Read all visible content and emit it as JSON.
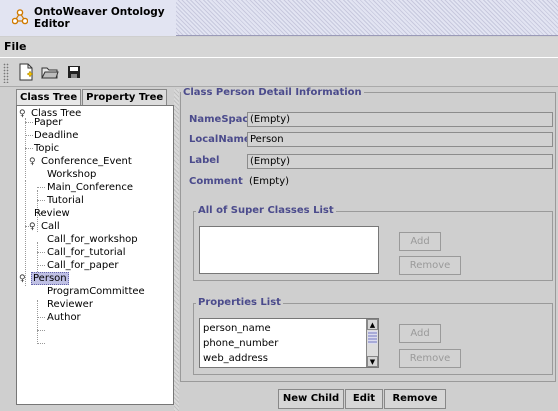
{
  "window": {
    "title": "OntoWeaver Ontology Editor"
  },
  "menu": {
    "items": [
      "File"
    ]
  },
  "toolbar": {
    "icons": [
      "new-file-icon",
      "open-folder-icon",
      "save-disk-icon"
    ]
  },
  "left_tabs": [
    "Class Tree",
    "Property Tree"
  ],
  "tree": {
    "nodes": [
      {
        "label": "Class Tree",
        "expanded": true
      },
      {
        "label": "Paper"
      },
      {
        "label": "Deadline"
      },
      {
        "label": "Topic"
      },
      {
        "label": "Conference_Event",
        "expanded": true
      },
      {
        "label": "Workshop"
      },
      {
        "label": "Main_Conference"
      },
      {
        "label": "Tutorial"
      },
      {
        "label": "Review"
      },
      {
        "label": "Call",
        "expanded": true
      },
      {
        "label": "Call_for_workshop"
      },
      {
        "label": "Call_for_tutorial"
      },
      {
        "label": "Call_for_paper"
      },
      {
        "label": "Person",
        "expanded": true,
        "selected": true
      },
      {
        "label": "ProgramCommittee"
      },
      {
        "label": "Reviewer"
      },
      {
        "label": "Author"
      }
    ]
  },
  "detail": {
    "group_title": "Class Person Detail Information",
    "namespace_label": "NameSpace",
    "namespace_value": "(Empty)",
    "localname_label": "LocalName",
    "localname_value": "Person",
    "label_label": "Label",
    "label_value": "(Empty)",
    "comment_label": "Comment",
    "comment_value": "(Empty)"
  },
  "super_classes": {
    "title": "All of Super Classes List",
    "items": [],
    "add_label": "Add",
    "remove_label": "Remove"
  },
  "properties": {
    "title": "Properties List",
    "items": [
      "person_name",
      "phone_number",
      "web_address"
    ],
    "add_label": "Add",
    "remove_label": "Remove"
  },
  "bottom_buttons": [
    "New Child",
    "Edit",
    "Remove"
  ],
  "colors": {
    "label_blue": "#4b4b8c",
    "selection": "#bfc0e4"
  }
}
